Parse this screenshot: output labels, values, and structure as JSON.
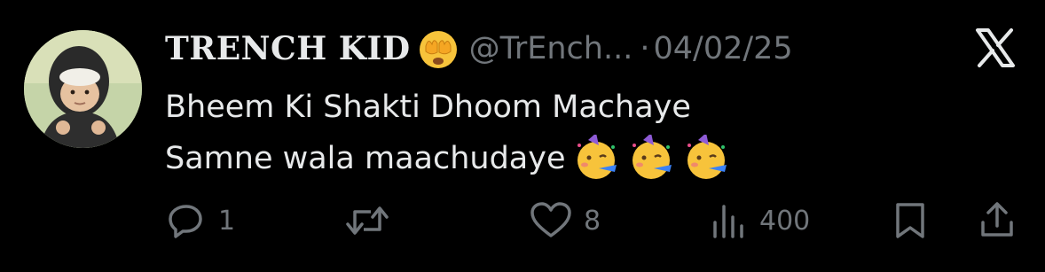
{
  "tweet": {
    "display_name": "TRENCH KID",
    "handle": "@TrEnch...",
    "separator": "·",
    "date": "04/02/25",
    "text_line1": "Bheem Ki Shakti Dhoom Machaye",
    "text_line2": "Samne wala maachudaye",
    "name_emoji": "face-with-hands-over-eyes-icon",
    "text_emojis": [
      "partying-face-icon",
      "partying-face-icon",
      "partying-face-icon"
    ]
  },
  "actions": {
    "replies": "1",
    "retweets": "",
    "likes": "8",
    "views": "400"
  },
  "colors": {
    "background": "#000000",
    "text": "#e7e9ea",
    "muted": "#71767b",
    "emoji_yellow": "#f7c33b"
  }
}
